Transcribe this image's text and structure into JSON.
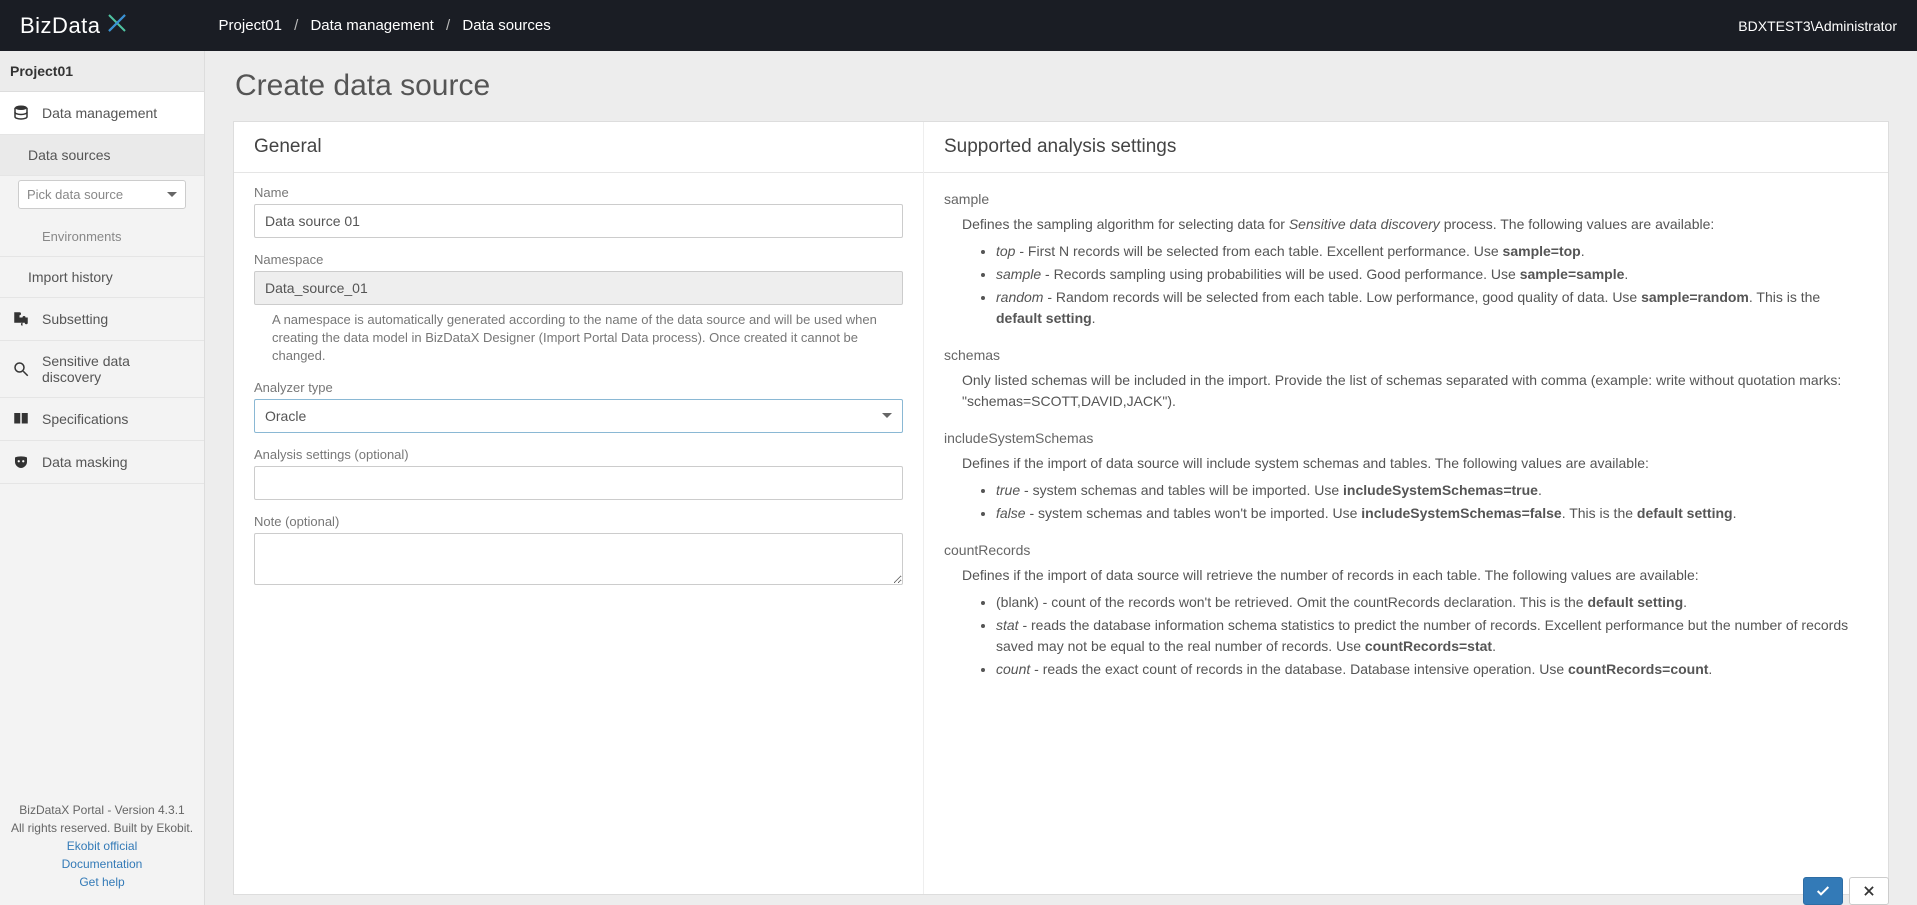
{
  "topbar": {
    "logo_text": "BizData",
    "breadcrumb": [
      "Project01",
      "Data management",
      "Data sources"
    ],
    "user": "BDXTEST3\\Administrator"
  },
  "sidebar": {
    "project": "Project01",
    "data_management": "Data management",
    "data_sources": "Data sources",
    "pick_source_placeholder": "Pick data source",
    "environments": "Environments",
    "import_history": "Import history",
    "subsetting": "Subsetting",
    "sensitive": "Sensitive data discovery",
    "specs": "Specifications",
    "masking": "Data masking",
    "footer_version": "BizDataX Portal - Version 4.3.1",
    "footer_rights": "All rights reserved. Built by Ekobit.",
    "footer_link1": "Ekobit official",
    "footer_link2": "Documentation",
    "footer_link3": "Get help"
  },
  "page": {
    "title": "Create data source",
    "general_heading": "General",
    "supported_heading": "Supported analysis settings",
    "labels": {
      "name": "Name",
      "namespace": "Namespace",
      "analyzer": "Analyzer type",
      "analysis_settings": "Analysis settings (optional)",
      "note": "Note (optional)"
    },
    "values": {
      "name": "Data source 01",
      "namespace": "Data_source_01",
      "analyzer": "Oracle",
      "analysis_settings": "",
      "note": ""
    },
    "namespace_hint": "A namespace is automatically generated according to the name of the data source and will be used when creating the data model in BizDataX Designer (Import Portal Data process). Once created it cannot be changed."
  },
  "help": {
    "sample_key": "sample",
    "sample_desc_pre": "Defines the sampling algorithm for selecting data for ",
    "sample_desc_em": "Sensitive data discovery",
    "sample_desc_post": " process. The following values are available:",
    "sample_li1_em": "top",
    "sample_li1_txt": " - First N records will be selected from each table. Excellent performance. Use ",
    "sample_li1_b": "sample=top",
    "sample_li2_em": "sample",
    "sample_li2_txt": " - Records sampling using probabilities will be used. Good performance. Use ",
    "sample_li2_b": "sample=sample",
    "sample_li3_em": "random",
    "sample_li3_txt": " - Random records will be selected from each table. Low performance, good quality of data. Use ",
    "sample_li3_b": "sample=random",
    "sample_li3_tail": ". This is the ",
    "sample_li3_b2": "default setting",
    "schemas_key": "schemas",
    "schemas_desc": "Only listed schemas will be included in the import. Provide the list of schemas separated with comma (example: write without quotation marks: \"schemas=SCOTT,DAVID,JACK\").",
    "include_key": "includeSystemSchemas",
    "include_desc": "Defines if the import of data source will include system schemas and tables. The following values are available:",
    "include_li1_em": "true",
    "include_li1_txt": " - system schemas and tables will be imported. Use ",
    "include_li1_b": "includeSystemSchemas=true",
    "include_li2_em": "false",
    "include_li2_txt": " - system schemas and tables won't be imported. Use ",
    "include_li2_b": "includeSystemSchemas=false",
    "include_li2_tail": ". This is the ",
    "include_li2_b2": "default setting",
    "count_key": "countRecords",
    "count_desc": "Defines if the import of data source will retrieve the number of records in each table. The following values are available:",
    "count_li1_txt": "(blank) - count of the records won't be retrieved. Omit the countRecords declaration. This is the ",
    "count_li1_b": "default setting",
    "count_li2_em": "stat",
    "count_li2_txt": " - reads the database information schema statistics to predict the number of records. Excellent performance but the number of records saved may not be equal to the real number of records. Use ",
    "count_li2_b": "countRecords=stat",
    "count_li3_em": "count",
    "count_li3_txt": " - reads the exact count of records in the database. Database intensive operation. Use ",
    "count_li3_b": "countRecords=count"
  }
}
